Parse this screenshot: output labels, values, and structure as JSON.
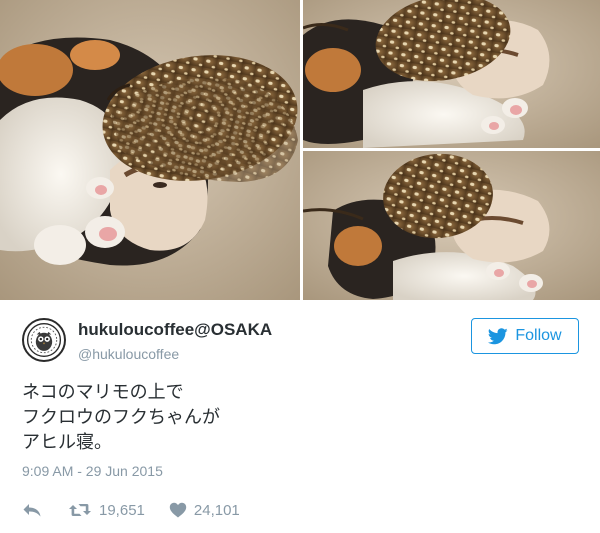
{
  "tweet": {
    "display_name": "hukuloucoffee@OSAKA",
    "handle": "@hukuloucoffee",
    "text_lines": [
      "ネコのマリモの上で",
      "フクロウのフクちゃんが",
      "アヒル寝。"
    ],
    "timestamp": "9:09 AM - 29 Jun 2015",
    "follow_label": "Follow",
    "retweet_count": "19,651",
    "like_count": "24,101"
  },
  "colors": {
    "accent": "#1b95e0",
    "text": "#292f33",
    "muted": "#8899a6"
  },
  "icons": {
    "follow": "twitter-bird-icon",
    "reply": "reply-icon",
    "retweet": "retweet-icon",
    "like": "heart-icon"
  }
}
